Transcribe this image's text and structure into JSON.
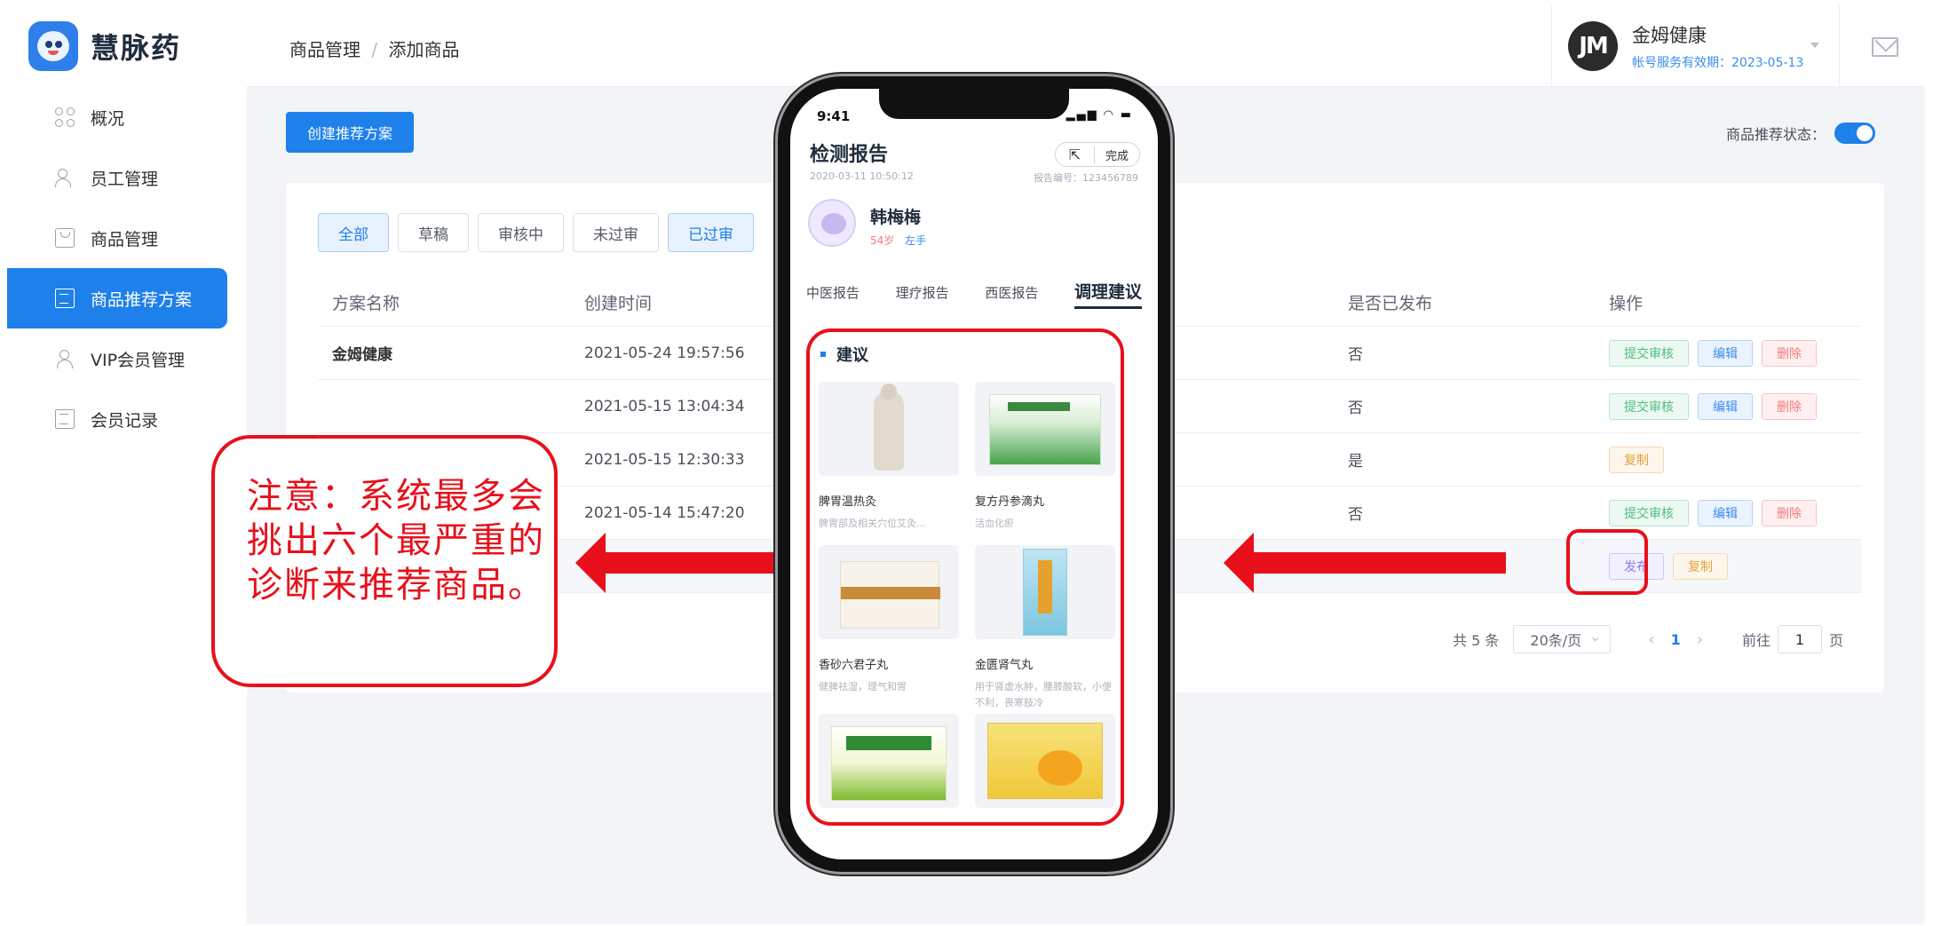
{
  "app": {
    "logo_text": "慧脉药"
  },
  "sidebar": {
    "items": [
      {
        "label": "概况",
        "icon": "grid-icon"
      },
      {
        "label": "员工管理",
        "icon": "users-icon"
      },
      {
        "label": "商品管理",
        "icon": "bag-icon"
      },
      {
        "label": "商品推荐方案",
        "icon": "document-icon",
        "active": true
      },
      {
        "label": "VIP会员管理",
        "icon": "vip-user-icon"
      },
      {
        "label": "会员记录",
        "icon": "list-icon"
      }
    ]
  },
  "header": {
    "breadcrumb": [
      "商品管理",
      "添加商品"
    ],
    "breadcrumb_sep": "/",
    "user_name": "金姆健康",
    "user_avatar_text": "JM",
    "user_expiry": "帐号服务有效期：2023-05-13"
  },
  "toolbar": {
    "create_label": "创建推荐方案",
    "rec_status_label": "商品推荐状态：",
    "rec_status_on": true
  },
  "filters": [
    "全部",
    "草稿",
    "审核中",
    "未过审",
    "已过审"
  ],
  "table": {
    "columns": [
      "方案名称",
      "创建时间",
      "是否已发布",
      "操作"
    ],
    "rows": [
      {
        "name": "金姆健康",
        "time": "2021-05-24 19:57:56",
        "published": "否",
        "ops": [
          "提交审核",
          "编辑",
          "删除"
        ]
      },
      {
        "name": "",
        "time": "2021-05-15 13:04:34",
        "published": "否",
        "ops": [
          "提交审核",
          "编辑",
          "删除"
        ]
      },
      {
        "name": "",
        "time": "2021-05-15 12:30:33",
        "published": "是",
        "ops": [
          "复制"
        ]
      },
      {
        "name": "",
        "time": "2021-05-14 15:47:20",
        "published": "否",
        "ops": [
          "提交审核",
          "编辑",
          "删除"
        ]
      },
      {
        "name": "",
        "time": "",
        "published": "",
        "ops": [
          "发布",
          "复制"
        ]
      }
    ]
  },
  "pager": {
    "total": "共 5 条",
    "page_size": "20条/页",
    "current": "1",
    "goto_label": "前往",
    "goto_value": "1",
    "page_unit": "页"
  },
  "annotation": {
    "note": "注意：系统最多会挑出六个最严重的诊断来推荐商品。",
    "color": "#e8101a"
  },
  "phone": {
    "time": "9:41",
    "title": "检测报告",
    "done_label": "完成",
    "date": "2020-03-11 10:50:12",
    "report_no": "报告编号：123456789",
    "patient_name": "韩梅梅",
    "patient_age": "54岁",
    "patient_hand": "左手",
    "tabs": [
      "中医报告",
      "理疗报告",
      "西医报告",
      "调理建议"
    ],
    "section_title": "建议",
    "products": [
      {
        "name": "脾胃温热灸",
        "desc": "脾胃部及相关穴位艾灸..."
      },
      {
        "name": "复方丹参滴丸",
        "desc": "活血化瘀"
      },
      {
        "name": "香砂六君子丸",
        "desc": "健脾祛湿，理气和胃"
      },
      {
        "name": "金匮肾气丸",
        "desc": "用于肾虚水肿，腰膝酸软，小便不利，畏寒肢冷"
      },
      {
        "name": "",
        "desc": ""
      },
      {
        "name": "",
        "desc": ""
      }
    ]
  },
  "colors": {
    "primary": "#1e80ea",
    "annotation_red": "#e8101a"
  }
}
